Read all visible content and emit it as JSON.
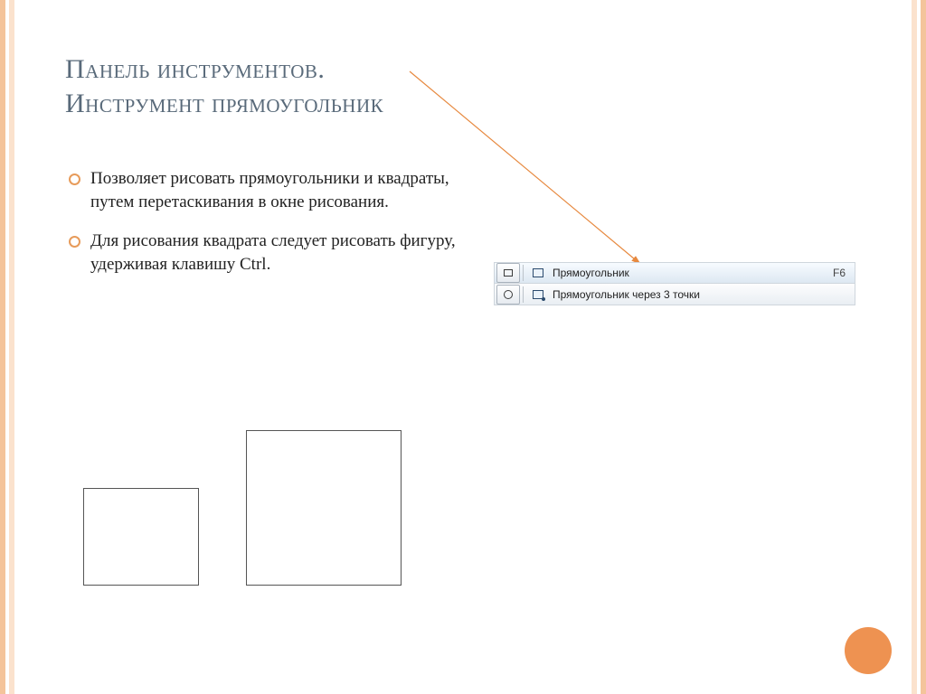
{
  "title": {
    "line1": "Панель инструментов.",
    "line2": "Инструмент прямоугольник"
  },
  "bullets": [
    "Позволяет рисовать прямоугольники и квадраты, путем перетаскивания в окне рисования.",
    "Для рисования квадрата следует рисовать фигуру, удерживая клавишу Ctrl."
  ],
  "toolbar": {
    "items": [
      {
        "label": "Прямоугольник",
        "shortcut": "F6"
      },
      {
        "label": "Прямоугольник через 3 точки",
        "shortcut": ""
      }
    ]
  }
}
